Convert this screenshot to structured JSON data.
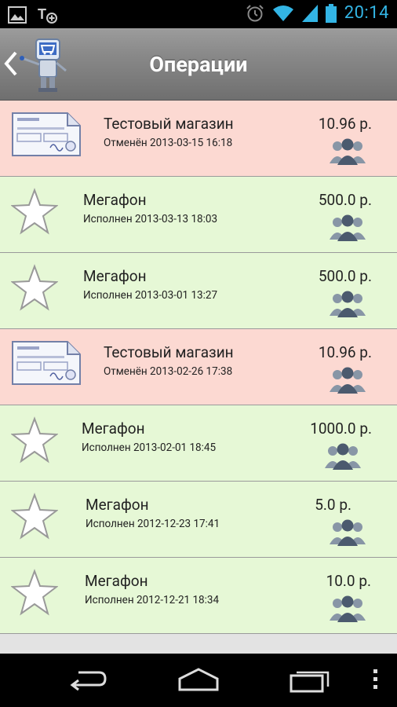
{
  "status_bar": {
    "time": "20:14",
    "icons": [
      "image-icon",
      "text-plus-icon",
      "alarm-icon",
      "wifi-icon",
      "signal-icon",
      "battery-icon"
    ]
  },
  "action_bar": {
    "title": "Операции",
    "back_icon": "chevron-left-icon",
    "logo_icon": "robot-cart-icon"
  },
  "operations": [
    {
      "type": "cancel",
      "name": "Тестовый магазин",
      "status": "Отменён 2013-03-15 16:18",
      "amount": "10.96 р."
    },
    {
      "type": "done",
      "name": "Мегафон",
      "status": "Исполнен 2013-03-13 18:03",
      "amount": "500.0 р."
    },
    {
      "type": "done",
      "name": "Мегафон",
      "status": "Исполнен 2013-03-01 13:27",
      "amount": "500.0 р."
    },
    {
      "type": "cancel",
      "name": "Тестовый магазин",
      "status": "Отменён 2013-02-26 17:38",
      "amount": "10.96 р."
    },
    {
      "type": "done",
      "name": "Мегафон",
      "status": "Исполнен 2013-02-01 18:45",
      "amount": "1000.0 р."
    },
    {
      "type": "done",
      "name": "Мегафон",
      "status": "Исполнен 2012-12-23 17:41",
      "amount": "5.0 р."
    },
    {
      "type": "done",
      "name": "Мегафон",
      "status": "Исполнен 2012-12-21 18:34",
      "amount": "10.0 р."
    }
  ],
  "colors": {
    "cancel_row": "#fcd9d2",
    "done_row": "#e6f8d6",
    "status_accent": "#33b5e5"
  },
  "nav_bar": {
    "icons": [
      "back-nav-icon",
      "home-nav-icon",
      "recent-apps-icon",
      "overflow-menu-icon"
    ]
  }
}
